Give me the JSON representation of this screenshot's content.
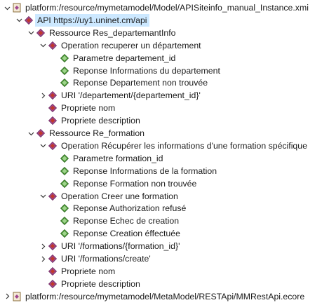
{
  "tree": {
    "rows": [
      {
        "text": "platform:/resource/mymetamodel/Model/APISiteinfo_manual_Instance.xmi",
        "depth": 0,
        "toggle": "expanded",
        "icon": "resource-file-icon"
      },
      {
        "text": "API https://uy1.uninet.cm/api",
        "depth": 1,
        "toggle": "expanded",
        "icon": "diamond-icon",
        "selected": true
      },
      {
        "text": "Ressource Res_departemantInfo",
        "depth": 2,
        "toggle": "expanded",
        "icon": "diamond-icon"
      },
      {
        "text": "Operation recuperer un département",
        "depth": 3,
        "toggle": "expanded",
        "icon": "diamond-icon"
      },
      {
        "text": "Parametre departement_id",
        "depth": 4,
        "toggle": "none",
        "icon": "green-diamond-icon"
      },
      {
        "text": "Reponse Informations du departement",
        "depth": 4,
        "toggle": "none",
        "icon": "green-diamond-icon"
      },
      {
        "text": "Reponse Departement non trouvée",
        "depth": 4,
        "toggle": "none",
        "icon": "green-diamond-icon"
      },
      {
        "text": "URI '/departement/{departement_id}'",
        "depth": 3,
        "toggle": "collapsed",
        "icon": "diamond-icon"
      },
      {
        "text": "Propriete nom",
        "depth": 3,
        "toggle": "none",
        "icon": "diamond-icon"
      },
      {
        "text": "Propriete description",
        "depth": 3,
        "toggle": "none",
        "icon": "diamond-icon"
      },
      {
        "text": "Ressource Re_formation",
        "depth": 2,
        "toggle": "expanded",
        "icon": "diamond-icon"
      },
      {
        "text": "Operation Récupérer les informations d'une formation spécifique",
        "depth": 3,
        "toggle": "expanded",
        "icon": "diamond-icon"
      },
      {
        "text": "Parametre formation_id",
        "depth": 4,
        "toggle": "none",
        "icon": "green-diamond-icon"
      },
      {
        "text": "Reponse Informations de la formation",
        "depth": 4,
        "toggle": "none",
        "icon": "green-diamond-icon"
      },
      {
        "text": "Reponse Formation non trouvée",
        "depth": 4,
        "toggle": "none",
        "icon": "green-diamond-icon"
      },
      {
        "text": "Operation Creer une formation",
        "depth": 3,
        "toggle": "expanded",
        "icon": "diamond-icon"
      },
      {
        "text": "Reponse Authorization refusé",
        "depth": 4,
        "toggle": "none",
        "icon": "green-diamond-icon"
      },
      {
        "text": "Reponse Echec de creation",
        "depth": 4,
        "toggle": "none",
        "icon": "green-diamond-icon"
      },
      {
        "text": "Reponse Creation éffectuée",
        "depth": 4,
        "toggle": "none",
        "icon": "green-diamond-icon"
      },
      {
        "text": "URI '/formations/{formation_id}'",
        "depth": 3,
        "toggle": "collapsed",
        "icon": "diamond-icon"
      },
      {
        "text": "URI '/formations/create'",
        "depth": 3,
        "toggle": "collapsed",
        "icon": "diamond-icon"
      },
      {
        "text": "Propriete nom",
        "depth": 3,
        "toggle": "none",
        "icon": "diamond-icon"
      },
      {
        "text": "Propriete description",
        "depth": 3,
        "toggle": "none",
        "icon": "diamond-icon"
      },
      {
        "text": "platform:/resource/mymetamodel/MetaModel/RESTApi/MMRestApi.ecore",
        "depth": 0,
        "toggle": "collapsed",
        "icon": "resource-file-icon"
      }
    ]
  },
  "colors": {
    "selection": "#cce8ff",
    "diamond_purple": "#a0488f",
    "diamond_red": "#c0392b",
    "diamond_green": "#4f9a3a",
    "toggle": "#333333"
  }
}
